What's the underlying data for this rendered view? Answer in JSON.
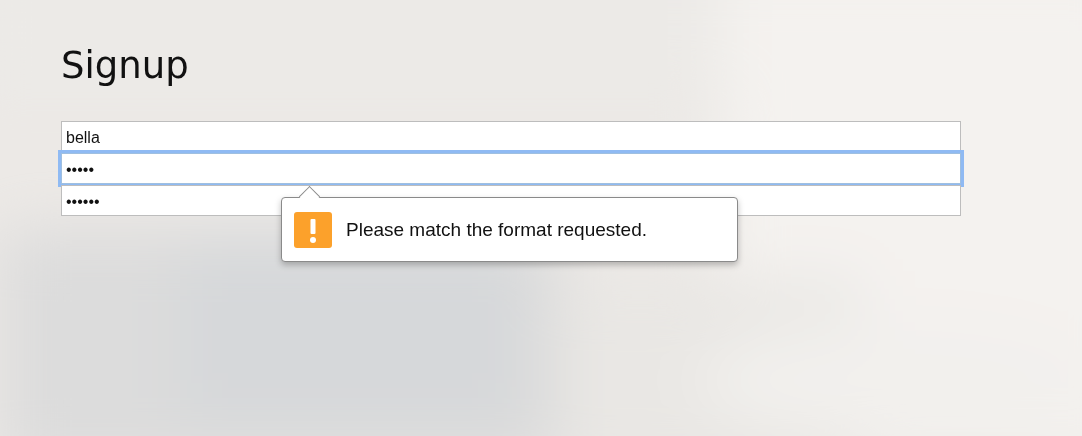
{
  "title": "Signup",
  "fields": [
    {
      "value": "bella",
      "focused": false
    },
    {
      "value": "•••••",
      "focused": true
    },
    {
      "value": "••••••",
      "focused": false
    }
  ],
  "tooltip": {
    "message": "Please match the format requested."
  }
}
